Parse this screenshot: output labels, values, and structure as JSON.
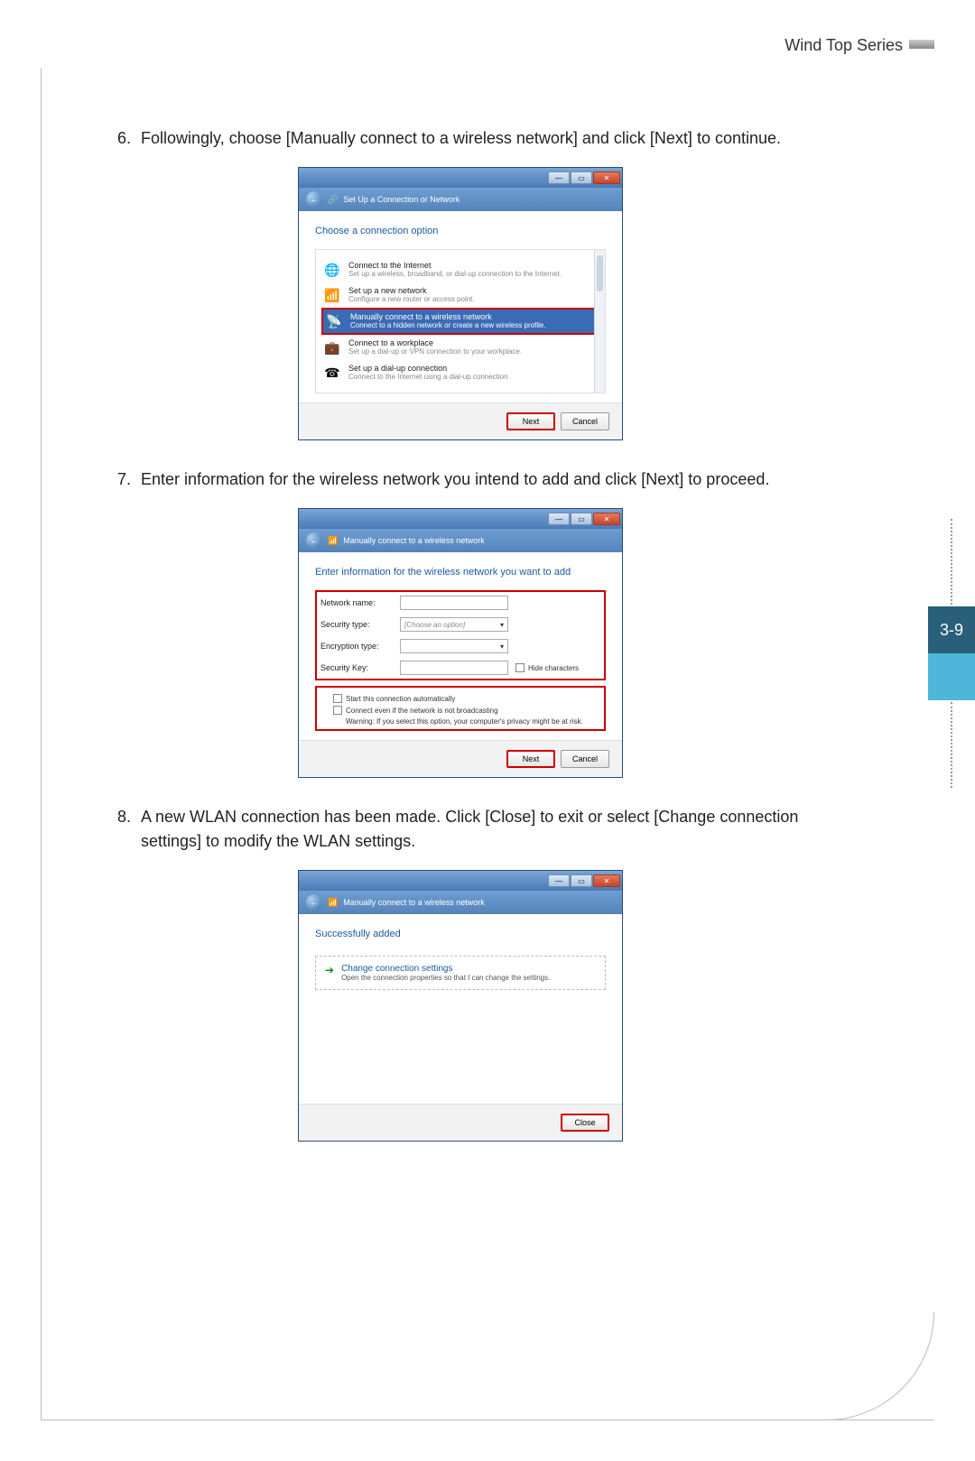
{
  "header": {
    "series": "Wind Top Series"
  },
  "page_number": "3-9",
  "steps": {
    "s6": {
      "num": "6.",
      "text": "Followingly, choose [Manually connect to a wireless network] and click [Next] to continue."
    },
    "s7": {
      "num": "7.",
      "text": "Enter information for the wireless network you intend to add and click [Next] to proceed."
    },
    "s8": {
      "num": "8.",
      "text": "A new WLAN connection has been made. Click [Close] to exit or select [Change connection settings] to modify the WLAN settings."
    }
  },
  "dialog1": {
    "title": "Set Up a Connection or Network",
    "heading": "Choose a connection option",
    "options": [
      {
        "icon": "🌐",
        "title": "Connect to the Internet",
        "desc": "Set up a wireless, broadband, or dial-up connection to the Internet."
      },
      {
        "icon": "📶",
        "title": "Set up a new network",
        "desc": "Configure a new router or access point."
      },
      {
        "icon": "📡",
        "title": "Manually connect to a wireless network",
        "desc": "Connect to a hidden network or create a new wireless profile."
      },
      {
        "icon": "💼",
        "title": "Connect to a workplace",
        "desc": "Set up a dial-up or VPN connection to your workplace."
      },
      {
        "icon": "☎",
        "title": "Set up a dial-up connection",
        "desc": "Connect to the Internet using a dial-up connection."
      }
    ],
    "next": "Next",
    "cancel": "Cancel"
  },
  "dialog2": {
    "title": "Manually connect to a wireless network",
    "heading": "Enter information for the wireless network you want to add",
    "labels": {
      "network": "Network name:",
      "security": "Security type:",
      "encryption": "Encryption type:",
      "key": "Security Key:"
    },
    "security_placeholder": "[Choose an option]",
    "hide_chars": "Hide characters",
    "chk1": "Start this connection automatically",
    "chk2": "Connect even if the network is not broadcasting",
    "warning": "Warning: If you select this option, your computer's privacy might be at risk.",
    "next": "Next",
    "cancel": "Cancel"
  },
  "dialog3": {
    "title": "Manually connect to a wireless network",
    "heading": "Successfully added",
    "link_title": "Change connection settings",
    "link_desc": "Open the connection properties so that I can change the settings.",
    "close": "Close"
  }
}
